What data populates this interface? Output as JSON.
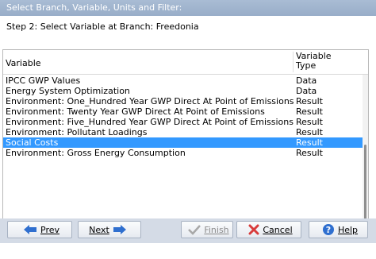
{
  "window": {
    "title": "Select Branch, Variable, Units and Filter:"
  },
  "step": {
    "label": "Step 2: Select Variable at Branch: Freedonia"
  },
  "table": {
    "columns": [
      "Variable",
      "Variable\nType"
    ],
    "column_variable": "Variable",
    "column_type_line1": "Variable",
    "column_type_line2": "Type",
    "rows": [
      {
        "variable": "IPCC GWP Values",
        "type": "Data"
      },
      {
        "variable": "Energy System Optimization",
        "type": "Data"
      },
      {
        "variable": "Environment: One_Hundred Year GWP Direct At Point of Emissions",
        "type": "Result"
      },
      {
        "variable": "Environment: Twenty Year GWP Direct At Point of Emissions",
        "type": "Result"
      },
      {
        "variable": "Environment: Five_Hundred Year GWP Direct At Point of Emissions",
        "type": "Result"
      },
      {
        "variable": "Environment: Pollutant Loadings",
        "type": "Result"
      },
      {
        "variable": "Social Costs",
        "type": "Result"
      },
      {
        "variable": "Environment: Gross Energy Consumption",
        "type": "Result"
      }
    ],
    "selected_index": 6
  },
  "buttons": {
    "prev": {
      "label": "Prev",
      "icon": "arrow-left-icon"
    },
    "next": {
      "label": "Next",
      "icon": "arrow-right-icon"
    },
    "finish": {
      "label": "Finish",
      "icon": "checkmark-icon",
      "disabled": true
    },
    "cancel": {
      "label": "Cancel",
      "icon": "close-x-icon"
    },
    "help": {
      "label": "Help",
      "icon": "help-question-icon"
    }
  },
  "colors": {
    "selection": "#3399ff",
    "titlebar": "#a9bcd4",
    "footer": "#d4dbe6",
    "arrow_blue": "#2f6fcf",
    "cancel_red": "#d83b3b"
  }
}
